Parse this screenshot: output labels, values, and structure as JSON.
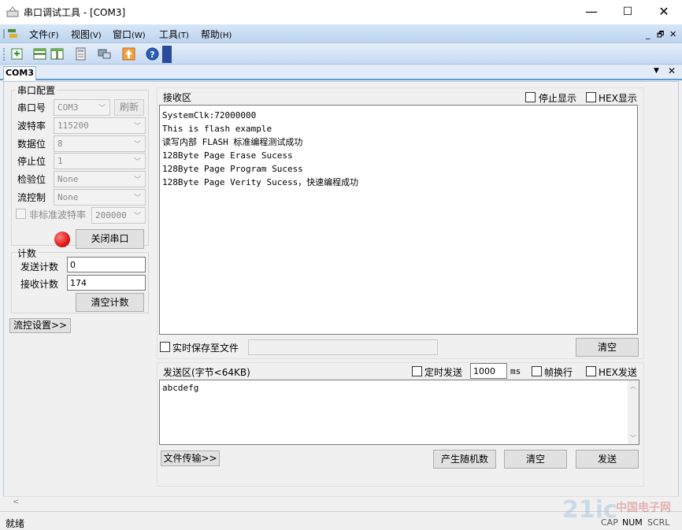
{
  "window": {
    "title": "串口调试工具 - [COM3]",
    "minimize": "—",
    "maximize": "☐",
    "close": "✕"
  },
  "menu": [
    {
      "label": "文件",
      "key": "(F)"
    },
    {
      "label": "视图",
      "key": "(V)"
    },
    {
      "label": "窗口",
      "key": "(W)"
    },
    {
      "label": "工具",
      "key": "(T)"
    },
    {
      "label": "帮助",
      "key": "(H)"
    }
  ],
  "mdi_controls": {
    "minimize": "_",
    "restore": "🗗",
    "close": "✕"
  },
  "tab": {
    "label": "COM3",
    "dropdown": "▼",
    "close": "✕"
  },
  "serial_config": {
    "group_title": "串口配置",
    "port_label": "串口号",
    "port_value": "COM3",
    "refresh_label": "刷新",
    "baud_label": "波特率",
    "baud_value": "115200",
    "databits_label": "数据位",
    "databits_value": "8",
    "stopbits_label": "停止位",
    "stopbits_value": "1",
    "parity_label": "检验位",
    "parity_value": "None",
    "flow_label": "流控制",
    "flow_value": "None",
    "nonstd_label": "非标准波特率",
    "nonstd_value": "200000",
    "close_port_label": "关闭串口",
    "status_color": "#e02020"
  },
  "counter": {
    "group_title": "计数",
    "send_label": "发送计数",
    "send_value": "0",
    "recv_label": "接收计数",
    "recv_value": "174",
    "clear_label": "清空计数"
  },
  "flow_settings_label": "流控设置>>",
  "receive": {
    "title": "接收区",
    "stop_display_label": "停止显示",
    "hex_display_label": "HEX显示",
    "lines": [
      "SystemClk:72000000",
      "This is flash example",
      "读写内部 FLASH 标准编程测试成功",
      "128Byte Page Erase Sucess",
      "128Byte Page Program Sucess",
      "128Byte Page Verity Sucess，快速编程成功"
    ],
    "save_to_file_label": "实时保存至文件",
    "file_path": "",
    "clear_label": "清空"
  },
  "send": {
    "title": "发送区(字节<64KB)",
    "timed_label": "定时发送",
    "interval_value": "1000",
    "interval_unit": "ms",
    "newline_label": "帧换行",
    "hex_send_label": "HEX发送",
    "content": "abcdefg",
    "file_transfer_label": "文件传输>>",
    "random_label": "产生随机数",
    "clear_label": "清空",
    "send_label": "发送"
  },
  "statusbar": {
    "text": "就绪",
    "cap": "CAP",
    "num": "NUM",
    "scrl": "SCRL"
  },
  "watermark": {
    "text": "21ic 中国电子网"
  }
}
